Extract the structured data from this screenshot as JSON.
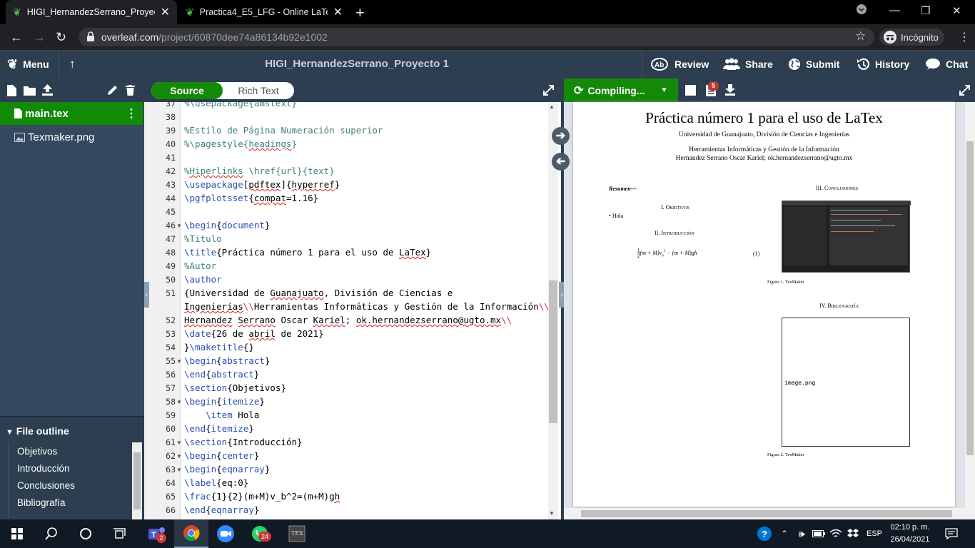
{
  "browser": {
    "tabs": [
      {
        "title": "HIGI_HernandezSerrano_Proyecto",
        "active": true
      },
      {
        "title": "Practica4_E5_LFG - Online LaTeX",
        "active": false
      }
    ],
    "url_host": "overleaf.com",
    "url_path": "/project/60870dee74a86134b92e1002",
    "incognito_label": "Incógnito"
  },
  "header": {
    "menu_label": "Menu",
    "project_title": "HIGI_HernandezSerrano_Proyecto 1",
    "review_label": "Review",
    "share_label": "Share",
    "submit_label": "Submit",
    "history_label": "History",
    "chat_label": "Chat"
  },
  "editor_toolbar": {
    "source_label": "Source",
    "rich_text_label": "Rich Text"
  },
  "pdf_toolbar": {
    "compile_label": "Compiling...",
    "log_badge": "5"
  },
  "files": [
    {
      "name": "main.tex",
      "selected": true
    },
    {
      "name": "Texmaker.png",
      "selected": false
    }
  ],
  "outline": {
    "title": "File outline",
    "items": [
      "Objetivos",
      "Introducción",
      "Conclusiones",
      "Bibliografía"
    ]
  },
  "code_lines": [
    {
      "n": "37",
      "html": "<span class='cmt'>%\\usepackage{amstext}</span>"
    },
    {
      "n": "38",
      "html": ""
    },
    {
      "n": "39",
      "html": "<span class='cmt'>%Estilo de Página Numeración superior</span>"
    },
    {
      "n": "40",
      "html": "<span class='cmt'>%\\pagestyle{<span class='sp'>headings</span>}</span>"
    },
    {
      "n": "41",
      "html": ""
    },
    {
      "n": "42",
      "html": "<span class='cmt'>%<span class='sp'>Hiperlinks</span> \\href{url}{text}</span>"
    },
    {
      "n": "43",
      "html": "<span class='cmd'>\\usepackage</span>[<span class='sp'>pdftex</span>]{<span class='sp'>hyperref</span>}"
    },
    {
      "n": "44",
      "html": "<span class='cmd'>\\pgfplotsset</span>{<span class='sp'>compat</span>=1.16}"
    },
    {
      "n": "45",
      "html": ""
    },
    {
      "n": "46",
      "fold": true,
      "html": "<span class='cmd'>\\begin</span>{<span class='cmd'>document</span>}"
    },
    {
      "n": "47",
      "html": "<span class='cmt'>%Titulo</span>"
    },
    {
      "n": "48",
      "html": "<span class='cmd'>\\title</span>{Práctica número 1 para el uso de <span class='sp'>LaTex</span>}"
    },
    {
      "n": "49",
      "html": "<span class='cmt'>%Autor</span>"
    },
    {
      "n": "50",
      "html": "<span class='cmd'>\\author</span>"
    },
    {
      "n": "51",
      "html": "{Universidad de <span class='sp'>Guanajuato</span>, División de Ciencias e"
    },
    {
      "n": "",
      "html": "<span class='sp'>Ingenierías</span><span style='color:#c33'>\\\\</span>Herramientas Informáticas y Gestión de la Información<span style='color:#c33'>\\\\</span>"
    },
    {
      "n": "52",
      "html": "<span class='sp'>Hernandez</span> <span class='sp'>Serrano</span> Oscar <span class='sp'>Kariel</span>; <span class='sp'>ok.hernandezserrano@ugto.mx</span><span style='color:#c33'>\\\\</span>"
    },
    {
      "n": "53",
      "html": "<span class='cmd'>\\date</span>{26 de <span class='sp'>abril</span> de 2021}"
    },
    {
      "n": "54",
      "html": "}<span class='cmd'>\\maketitle</span>{}"
    },
    {
      "n": "55",
      "fold": true,
      "html": "<span class='cmd'>\\begin</span>{<span class='cmd'>abstract</span>}"
    },
    {
      "n": "56",
      "html": "<span class='cmd'>\\end</span>{<span class='cmd'>abstract</span>}"
    },
    {
      "n": "57",
      "html": "<span class='cmd'>\\section</span>{Objetivos}"
    },
    {
      "n": "58",
      "fold": true,
      "html": "<span class='cmd'>\\begin</span>{<span class='cmd'>itemize</span>}"
    },
    {
      "n": "59",
      "html": "    <span class='cmd'>\\item</span> Hola"
    },
    {
      "n": "60",
      "html": "<span class='cmd'>\\end</span>{<span class='cmd'>itemize</span>}"
    },
    {
      "n": "61",
      "fold": true,
      "html": "<span class='cmd'>\\section</span>{Introducción}"
    },
    {
      "n": "62",
      "fold": true,
      "html": "<span class='cmd'>\\begin</span>{<span class='cmd'>center</span>}"
    },
    {
      "n": "63",
      "fold": true,
      "html": "<span class='cmd'>\\begin</span>{<span class='cmd'>eqnarray</span>}"
    },
    {
      "n": "64",
      "html": "<span class='cmd'>\\label</span>{eq:0}"
    },
    {
      "n": "65",
      "html": "<span class='cmd'>\\frac</span>{1}{2}(m+M)v_b^2=(m+M)<span class='sp'>gh</span>"
    },
    {
      "n": "66",
      "html": "<span class='cmd'>\\end</span>{<span class='cmd'>eqnarray</span>}"
    }
  ],
  "pdf": {
    "title": "Práctica número 1 para el uso de LaTex",
    "affiliation1": "Universidad de Guanajuato, División de Ciencias e Ingenierías",
    "affiliation2": "Herramientas Informáticas y Gestión de la Información",
    "author": "Hernandez Serrano Oscar Kariel; ok.hernandezserrano@ugto.mx",
    "resumen": "Resumen—",
    "sec1": "I.  Objetivos",
    "bullet": "Hola",
    "sec2": "II.  Introducción",
    "eq_number": "(1)",
    "sec3": "III.  Conclusiones",
    "fig1": "Figura 1.  TexMaker",
    "sec4": "IV.  Bibliografía",
    "placeholder": "image.png",
    "fig2": "Figura 2.  TexMaker"
  },
  "taskbar": {
    "teams_badge": "2",
    "whatsapp_badge": "24",
    "lang": "ESP",
    "time": "02:10 p. m.",
    "date": "26/04/2021"
  }
}
